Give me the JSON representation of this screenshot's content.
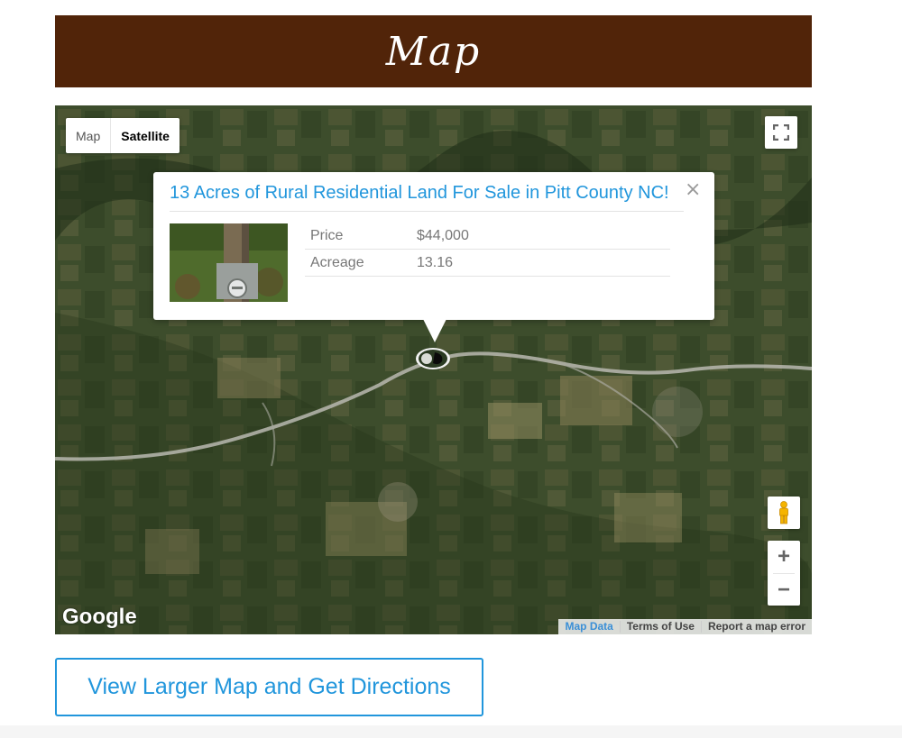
{
  "header": {
    "title": "Map"
  },
  "map": {
    "type_controls": {
      "map_label": "Map",
      "satellite_label": "Satellite",
      "active": "Satellite"
    },
    "info_window": {
      "title": "13 Acres of Rural Residential Land For Sale in Pitt County NC!",
      "close_glyph": "×",
      "details": [
        {
          "label": "Price",
          "value": "$44,000"
        },
        {
          "label": "Acreage",
          "value": "13.16"
        }
      ]
    },
    "zoom": {
      "in_label": "+",
      "out_label": "−"
    },
    "logo_text": "Google",
    "attribution": {
      "map_data": "Map Data",
      "terms": "Terms of Use",
      "report": "Report a map error"
    },
    "icons": [
      "fullscreen-icon",
      "pegman-icon",
      "map-marker-icon",
      "close-icon"
    ],
    "colors": {
      "header_bg": "#512409",
      "link_blue": "#2196dc",
      "road": "#b8b8b0"
    }
  },
  "cta": {
    "label": "View Larger Map and Get Directions"
  }
}
